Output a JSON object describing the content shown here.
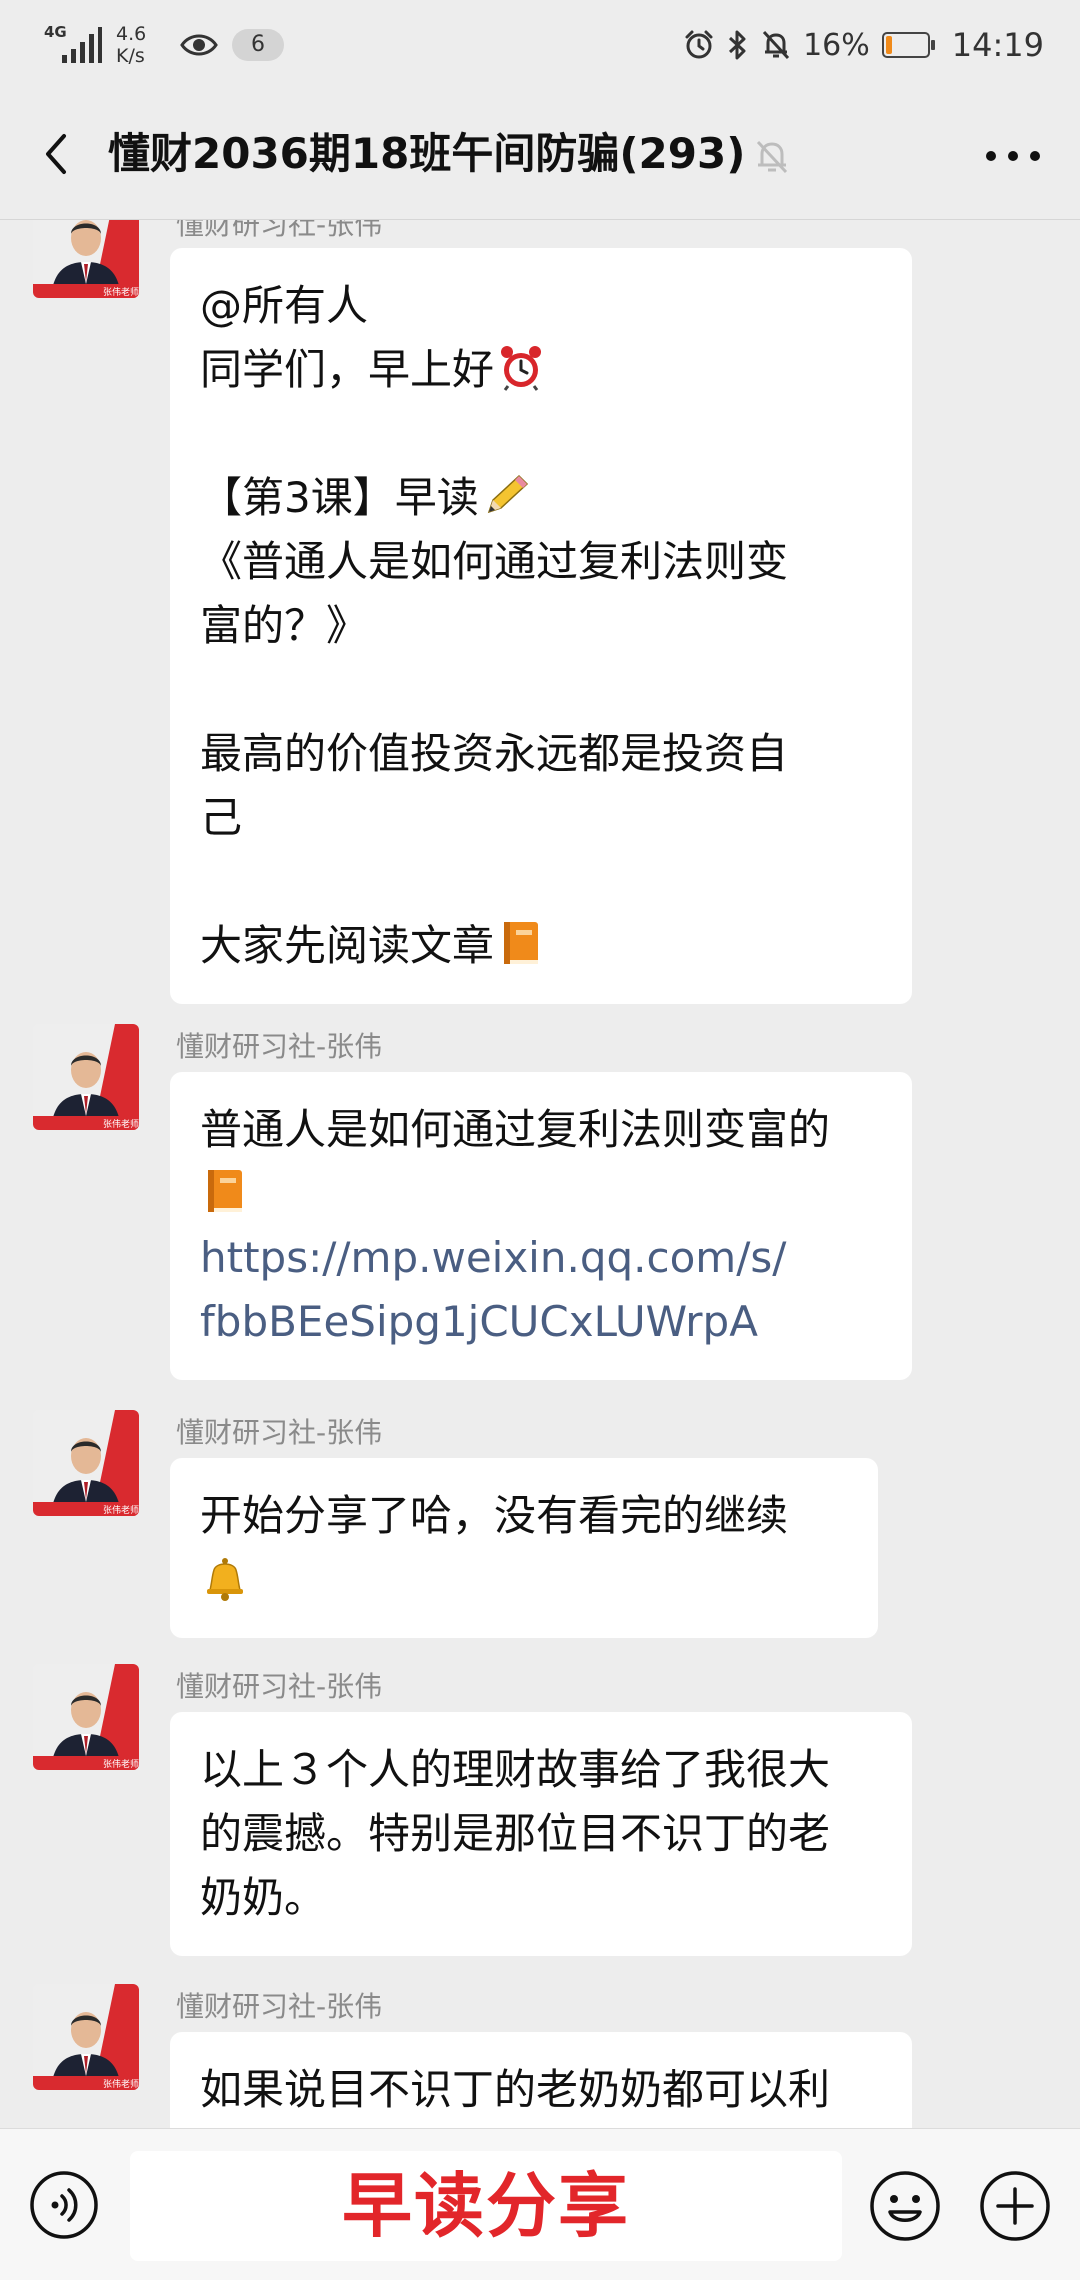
{
  "status_bar": {
    "network_type": "4G",
    "speed_value": "4.6",
    "speed_unit": "K/s",
    "notification_count": "6",
    "battery_percent": "16%",
    "battery_level": 0.16,
    "time": "14:19"
  },
  "header": {
    "title": "懂财2036期18班午间防骗(293)"
  },
  "messages": [
    {
      "sender": "懂财研习社-张伟",
      "lines": [
        "@所有人",
        "同学们，早上好",
        "",
        "【第3课】早读",
        "《普通人是如何通过复利法则变",
        "富的？》",
        "",
        "最高的价值投资永远都是投资自",
        "己",
        "",
        "大家先阅读文章"
      ]
    },
    {
      "sender": "懂财研习社-张伟",
      "lines": [
        "普通人是如何通过复利法则变富的"
      ],
      "link_lines": [
        "https://mp.weixin.qq.com/s/",
        "fbbBEeSipg1jCUCxLUWrpA"
      ]
    },
    {
      "sender": "懂财研习社-张伟",
      "lines": [
        "开始分享了哈，没有看完的继续"
      ]
    },
    {
      "sender": "懂财研习社-张伟",
      "lines": [
        "以上３个人的理财故事给了我很大",
        "的震撼。特别是那位目不识丁的老",
        "奶奶。"
      ]
    },
    {
      "sender": "懂财研习社-张伟",
      "lines": [
        "如果说目不识丁的老奶奶都可以利"
      ]
    }
  ],
  "avatar": {
    "caption": "张伟老师"
  },
  "input_bar": {
    "overlay_text": "早读分享"
  },
  "icons": {
    "signal": "signal-icon",
    "eye": "eye-icon",
    "alarm": "alarm-icon",
    "bluetooth": "bluetooth-icon",
    "mute": "bell-slash-icon",
    "battery": "battery-icon",
    "back": "back-arrow-icon",
    "more": "more-dots-icon",
    "voice": "voice-input-icon",
    "emoji": "emoji-icon",
    "plus": "plus-icon",
    "emoji_alarm_clock": "alarm-clock-emoji",
    "emoji_pencil": "pencil-emoji",
    "emoji_book": "orange-book-emoji",
    "emoji_bell": "bell-emoji"
  },
  "colors": {
    "background": "#ededed",
    "bubble": "#ffffff",
    "link": "#4a5e82",
    "overlay_red": "#e2262a",
    "battery_fill": "#f08a1a"
  }
}
